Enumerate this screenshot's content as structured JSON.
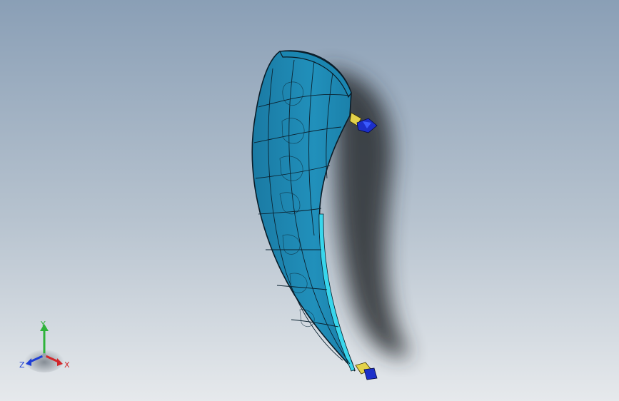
{
  "viewport": {
    "background_top": "#8a9fb6",
    "background_bottom": "#e6e9ec",
    "part_color": "#1f8cb5",
    "part_edge_color": "#0a1c28",
    "highlight_color": "#39d6ec",
    "fastener_colors": [
      "#e3d24a",
      "#1c2fc9"
    ]
  },
  "triad": {
    "x_label": "X",
    "y_label": "Y",
    "z_label": "Z",
    "x_color": "#d2262b",
    "y_color": "#2fb33a",
    "z_color": "#1f3fd6"
  }
}
